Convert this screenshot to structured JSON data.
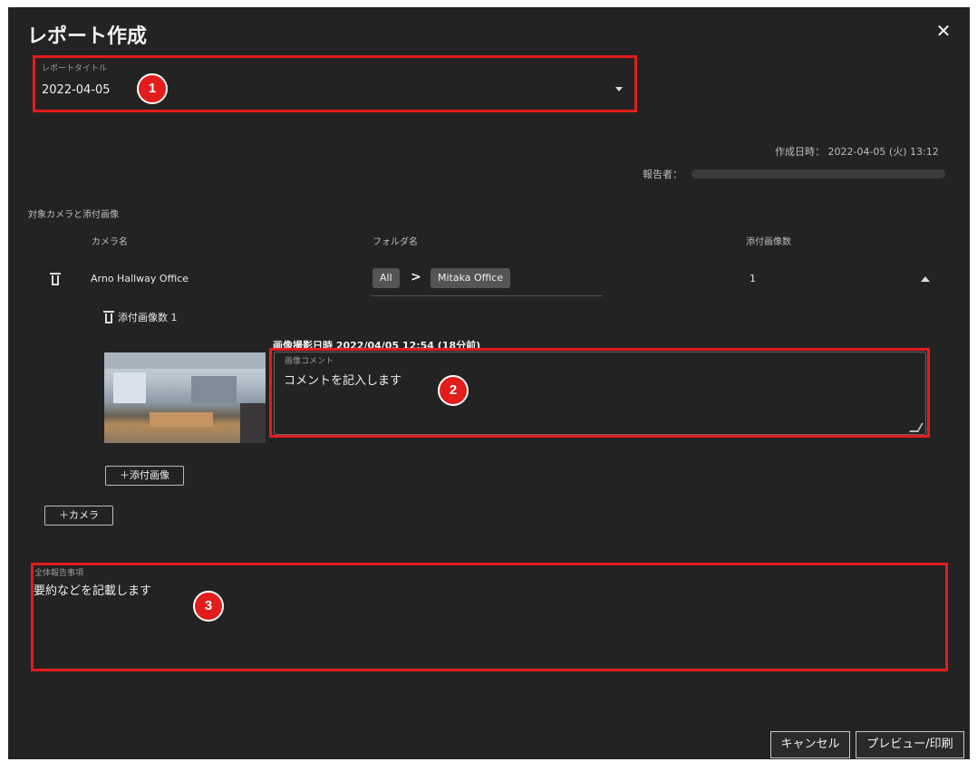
{
  "dialog": {
    "title": "レポート作成",
    "close_icon": "close-icon"
  },
  "report_title": {
    "legend": "レポートタイトル",
    "value": "2022-04-05"
  },
  "meta": {
    "created_label": "作成日時：",
    "created_value": "2022-04-05 (火) 13:12",
    "reporter_label": "報告者："
  },
  "camera_section": {
    "heading": "対象カメラと添付画像",
    "columns": [
      "カメラ名",
      "フォルダ名",
      "添付画像数"
    ],
    "row": {
      "camera_name": "Arno Hallway Office",
      "folder_root": "All",
      "folder_sep": ">",
      "folder_name": "Mitaka Office",
      "image_count": "1"
    },
    "attachment_label": "添付画像数 1",
    "capture_info": "画像撮影日時 2022/04/05 12:54 (18分前)",
    "comment_legend": "画像コメント",
    "comment_value": "コメントを記入します",
    "add_image_label": "＋添付画像",
    "add_camera_label": "＋カメラ"
  },
  "summary": {
    "legend": "全体報告事項",
    "value": "要約などを記載します"
  },
  "badges": [
    "1",
    "2",
    "3"
  ],
  "footer": {
    "cancel_label": "キャンセル",
    "preview_label": "プレビュー/印刷"
  },
  "colors": {
    "highlight": "#e31c1c",
    "background": "#232323"
  }
}
